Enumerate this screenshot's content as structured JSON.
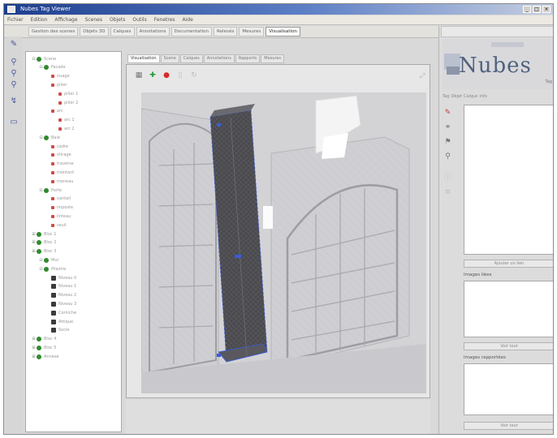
{
  "window": {
    "title": "Nubes Tag Viewer"
  },
  "menubar": [
    "Fichier",
    "Edition",
    "Affichage",
    "Scenes",
    "Objets",
    "Outils",
    "Fenetres",
    "Aide"
  ],
  "toolbar_tabs": [
    {
      "label": "Gestion des scenes",
      "active": false
    },
    {
      "label": "Objets 3D",
      "active": false
    },
    {
      "label": "Calques",
      "active": false
    },
    {
      "label": "Annotations",
      "active": false
    },
    {
      "label": "Documentation",
      "active": false
    },
    {
      "label": "Relevés",
      "active": false
    },
    {
      "label": "Mesures",
      "active": false
    },
    {
      "label": "Visualisation",
      "active": true
    }
  ],
  "tree": {
    "rows": [
      {
        "depth": 0,
        "expander": "⊟",
        "icon": "green",
        "label": "Scene"
      },
      {
        "depth": 1,
        "expander": "⊟",
        "icon": "green",
        "label": "Facade"
      },
      {
        "depth": 2,
        "expander": "",
        "icon": "red",
        "label": "nuage"
      },
      {
        "depth": 2,
        "expander": "",
        "icon": "red",
        "label": "pilier"
      },
      {
        "depth": 3,
        "expander": "",
        "icon": "red",
        "label": "pilier 1"
      },
      {
        "depth": 3,
        "expander": "",
        "icon": "red",
        "label": "pilier 2"
      },
      {
        "depth": 2,
        "expander": "",
        "icon": "red",
        "label": "arc"
      },
      {
        "depth": 3,
        "expander": "",
        "icon": "red",
        "label": "arc 1"
      },
      {
        "depth": 3,
        "expander": "",
        "icon": "red",
        "label": "arc 2"
      },
      {
        "depth": 1,
        "expander": "⊟",
        "icon": "green",
        "label": "Baie"
      },
      {
        "depth": 2,
        "expander": "",
        "icon": "red",
        "label": "cadre"
      },
      {
        "depth": 2,
        "expander": "",
        "icon": "red",
        "label": "vitrage"
      },
      {
        "depth": 2,
        "expander": "",
        "icon": "red",
        "label": "traverse"
      },
      {
        "depth": 2,
        "expander": "",
        "icon": "red",
        "label": "montant"
      },
      {
        "depth": 2,
        "expander": "",
        "icon": "red",
        "label": "meneau"
      },
      {
        "depth": 1,
        "expander": "⊟",
        "icon": "green",
        "label": "Porte"
      },
      {
        "depth": 2,
        "expander": "",
        "icon": "red",
        "label": "vantail"
      },
      {
        "depth": 2,
        "expander": "",
        "icon": "red",
        "label": "imposte"
      },
      {
        "depth": 2,
        "expander": "",
        "icon": "red",
        "label": "linteau"
      },
      {
        "depth": 2,
        "expander": "",
        "icon": "red",
        "label": "seuil"
      },
      {
        "depth": 0,
        "expander": "⊞",
        "icon": "green",
        "label": "Bloc 1"
      },
      {
        "depth": 0,
        "expander": "⊞",
        "icon": "green",
        "label": "Bloc 2"
      },
      {
        "depth": 0,
        "expander": "⊞",
        "icon": "green",
        "label": "Bloc 3"
      },
      {
        "depth": 1,
        "expander": "⊟",
        "icon": "green",
        "label": "Mur"
      },
      {
        "depth": 1,
        "expander": "⊟",
        "icon": "green",
        "label": "Pilastre"
      },
      {
        "depth": 2,
        "expander": "",
        "icon": "dark",
        "label": "Niveau 0"
      },
      {
        "depth": 2,
        "expander": "",
        "icon": "dark",
        "label": "Niveau 1"
      },
      {
        "depth": 2,
        "expander": "",
        "icon": "dark",
        "label": "Niveau 2"
      },
      {
        "depth": 2,
        "expander": "",
        "icon": "dark",
        "label": "Niveau 3"
      },
      {
        "depth": 2,
        "expander": "",
        "icon": "dark",
        "label": "Corniche"
      },
      {
        "depth": 2,
        "expander": "",
        "icon": "dark",
        "label": "Attique"
      },
      {
        "depth": 2,
        "expander": "",
        "icon": "dark",
        "label": "Socle"
      },
      {
        "depth": 0,
        "expander": "⊞",
        "icon": "green",
        "label": "Bloc 4"
      },
      {
        "depth": 0,
        "expander": "⊞",
        "icon": "green",
        "label": "Bloc 5"
      },
      {
        "depth": 0,
        "expander": "⊞",
        "icon": "green",
        "label": "Annexe"
      }
    ]
  },
  "viewer": {
    "tabs": [
      {
        "label": "Visualisation",
        "active": true
      },
      {
        "label": "Scene",
        "active": false
      },
      {
        "label": "Calques",
        "active": false
      },
      {
        "label": "Annotations",
        "active": false
      },
      {
        "label": "Rapports",
        "active": false
      },
      {
        "label": "Mesures",
        "active": false
      }
    ]
  },
  "right_panel": {
    "logo_text": "Nubes",
    "logo_sub": "Tag",
    "mini_tabs": [
      "Tag",
      "Objet",
      "Calque",
      "Info"
    ],
    "list_button": "Ajouter un lien",
    "images_label": "Images liées",
    "images_button": "Voir tout",
    "docs_label": "Images rapportées",
    "docs_button": "Voir tout"
  },
  "colors": {
    "titlebar": "#1d3e8e",
    "selection_highlight": "#3b5bd9",
    "tree_node": "#2f8a2a"
  }
}
